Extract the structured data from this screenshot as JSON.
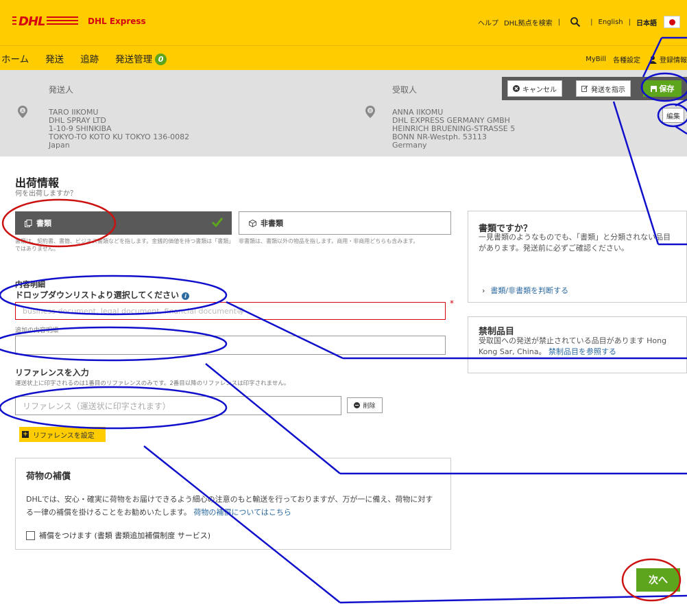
{
  "header": {
    "logo": "DHL",
    "brand": "DHL Express",
    "help": "ヘルプ",
    "find_location": "DHL拠点を検索",
    "lang_en": "English",
    "lang_ja": "日本語"
  },
  "nav": {
    "items": [
      "ホーム",
      "発送",
      "追跡",
      "発送管理"
    ],
    "badge_count": "0",
    "mybill": "MyBill",
    "settings": "各種設定",
    "registration": "登録情報"
  },
  "shipper": {
    "title": "発送人",
    "lines": [
      "TARO IIKOMU",
      "DHL SPRAY LTD",
      "1-10-9 SHINKIBA",
      "TOKYO-TO KOTO KU TOKYO 136-0082",
      "Japan"
    ]
  },
  "receiver": {
    "title": "受取人",
    "lines": [
      "ANNA IIKOMU",
      "DHL EXPRESS GERMANY GMBH",
      "HEINRICH BRUENING-STRASSE 5",
      "BONN NR-Westph. 53113",
      "Germany"
    ]
  },
  "actions": {
    "cancel": "キャンセル",
    "instruct": "発送を指示",
    "save": "保存",
    "edit": "編集"
  },
  "shipment": {
    "title": "出荷情報",
    "subtitle": "何を出荷しますか？",
    "doc_label": "書類",
    "nondoc_label": "非書類",
    "doc_desc": "書類は、契約書、書簡、ビジネス書類などを指します。金銭的価値を持つ書類は「書類」ではありません。",
    "nondoc_desc": "非書類は、書類以外の物品を指します。商用・非商用どちらも含みます。",
    "contents_label": "内容明細",
    "contents_sub": "ドロップダウンリストより選択してください",
    "contents_placeholder": "business document, legal document, financial document等",
    "required_mark": "*",
    "additional_label": "追加の内容明細",
    "additional_value": "",
    "reference_label": "リファレンスを入力",
    "reference_hint": "運送状上に印字されるのは1番目のリファレンスのみです。2番目以降のリファレンスは印字されません。",
    "reference_placeholder": "リファレンス（運送状に印字されます）",
    "delete": "削除",
    "add_reference": "リファレンスを設定"
  },
  "insurance": {
    "title": "荷物の補償",
    "text": "DHLでは、安心・確実に荷物をお届けできるよう細心の注意のもと輸送を行っておりますが、万が一に備え、荷物に対する一律の補償を掛けることをお勧めいたします。",
    "link": "荷物の補償についてはこちら",
    "checkbox_label": "補償をつけます (書類 書類追加補償制度 サービス)"
  },
  "side_doc": {
    "title": "書類ですか？",
    "text": "一見書類のようなものでも、「書類」と分類されない品目があります。発送前に必ずご確認ください。",
    "link": "書類/非書類を判断する"
  },
  "side_prohibited": {
    "title": "禁制品目",
    "text": "受取国への発送が禁止されている品目があります Hong Kong Sar, China。",
    "link": "禁制品目を参照する"
  },
  "footer": {
    "next": "次へ"
  },
  "colors": {
    "dhl_yellow": "#ffcc00",
    "dhl_red": "#d40511",
    "green": "#5ea51e",
    "annotation_blue": "#1010cc",
    "annotation_red": "#cc1111"
  }
}
